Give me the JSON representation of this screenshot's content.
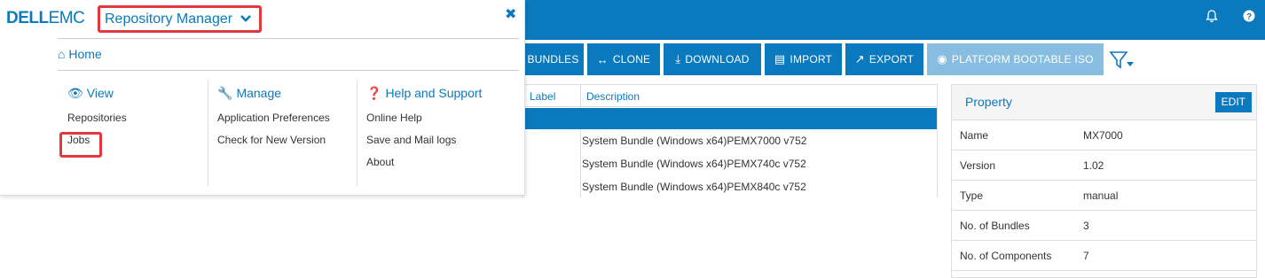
{
  "header": {
    "bell_icon": "bell-icon",
    "help_glyph": "?"
  },
  "toolbar": {
    "buttons": [
      {
        "label": "BUNDLES",
        "icon": ""
      },
      {
        "label": "CLONE",
        "icon": "↔"
      },
      {
        "label": "DOWNLOAD",
        "icon": "⤓"
      },
      {
        "label": "IMPORT",
        "icon": "▤"
      },
      {
        "label": "EXPORT",
        "icon": "↗"
      },
      {
        "label": "PLATFORM BOOTABLE ISO",
        "icon": "◉"
      }
    ],
    "filter_icon": "filter-icon"
  },
  "table": {
    "columns": [
      "Label",
      "Description"
    ],
    "rows": [
      {
        "label": "",
        "description": ""
      },
      {
        "label": "",
        "description": "System Bundle (Windows x64)PEMX7000 v752"
      },
      {
        "label": "",
        "description": "System Bundle (Windows x64)PEMX740c v752"
      },
      {
        "label": "",
        "description": "System Bundle (Windows x64)PEMX840c v752"
      }
    ]
  },
  "property": {
    "title": "Property",
    "edit_label": "EDIT",
    "rows": [
      {
        "key": "Name",
        "value": "MX7000"
      },
      {
        "key": "Version",
        "value": "1.02"
      },
      {
        "key": "Type",
        "value": "manual"
      },
      {
        "key": "No. of Bundles",
        "value": "3"
      },
      {
        "key": "No. of Components",
        "value": "7"
      }
    ]
  },
  "menu": {
    "logo_dell": "DELL",
    "logo_emc": "EMC",
    "app_name": "Repository Manager",
    "home": "Home",
    "columns": [
      {
        "title": "View",
        "icon": "eye-icon",
        "items": [
          "Repositories",
          "Jobs"
        ]
      },
      {
        "title": "Manage",
        "icon": "wrench-icon",
        "items": [
          "Application Preferences",
          "Check for New Version"
        ]
      },
      {
        "title": "Help and Support",
        "icon": "question-circle-icon",
        "items": [
          "Online Help",
          "Save and Mail logs",
          "About"
        ]
      }
    ]
  },
  "colors": {
    "brand_blue": "#0b79bd",
    "highlight_red": "#e0383e"
  }
}
